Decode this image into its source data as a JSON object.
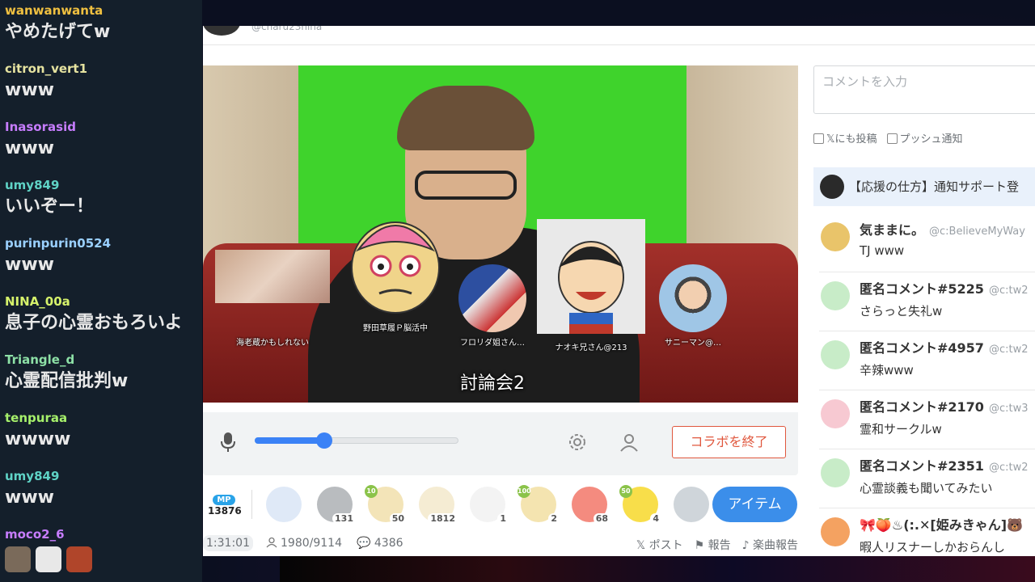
{
  "overlay_chat": [
    {
      "user": "wanwanwanta",
      "text": "やめたげてw",
      "color": "#f0c040"
    },
    {
      "user": "citron_vert1",
      "text": "www",
      "color": "#e6e3a0"
    },
    {
      "user": "Inasorasid",
      "text": "www",
      "color": "#c77dff"
    },
    {
      "user": "umy849",
      "text": "いいぞー！",
      "color": "#5fd3c6"
    },
    {
      "user": "purinpurin0524",
      "text": "www",
      "color": "#9ad0ff"
    },
    {
      "user": "NINA_00a",
      "text": "息子の心霊おもろいよ",
      "color": "#d6f26b"
    },
    {
      "user": "Triangle_d",
      "text": "心霊配信批判w",
      "color": "#8de0a6"
    },
    {
      "user": "tenpuraa",
      "text": "wwww",
      "color": "#a6f06b"
    },
    {
      "user": "umy849",
      "text": "www",
      "color": "#5fd3c6"
    },
    {
      "user": "moco2_6",
      "text": "",
      "color": "#c77dff"
    }
  ],
  "host": {
    "id": "@charu23nina"
  },
  "video": {
    "title": "討論会2",
    "collaborators": [
      {
        "name": "海老蔵かもしれない"
      },
      {
        "name": "野田草履Ｐ脳活中"
      },
      {
        "name": "フロリダ姐さん…"
      },
      {
        "name": "ナオキ兄さん@213"
      },
      {
        "name": "サニーマン@…"
      }
    ]
  },
  "controls": {
    "volume": 0.34,
    "end_collab_label": "コラボを終了"
  },
  "itembar": {
    "mp_label": "MP",
    "mp_value": "13876",
    "items": [
      {
        "count": "",
        "level": "",
        "color": "#dfe9f7"
      },
      {
        "count": "131",
        "level": "",
        "color": "#b9bcbf"
      },
      {
        "count": "50",
        "level": "10",
        "color": "#f3e4b8"
      },
      {
        "count": "1812",
        "level": "",
        "color": "#f5ecd3"
      },
      {
        "count": "1",
        "level": "",
        "color": "#f3f3f3"
      },
      {
        "count": "2",
        "level": "100",
        "color": "#f4e4b0"
      },
      {
        "count": "68",
        "level": "",
        "color": "#f48b7f"
      },
      {
        "count": "4",
        "level": "50",
        "color": "#f8de4a"
      },
      {
        "count": "",
        "level": "",
        "color": "#cfd5da"
      }
    ],
    "items_button": "アイテム"
  },
  "stats": {
    "elapsed": "1:31:01",
    "viewers": "1980/9114",
    "comments": "4386"
  },
  "links": {
    "post": "ポスト",
    "report": "報告",
    "music_report": "楽曲報告"
  },
  "side": {
    "input_placeholder": "コメントを入力",
    "opt_x": "にも投稿",
    "opt_push": "プッシュ通知",
    "pinned": "【応援の仕方】通知サポート登",
    "comments": [
      {
        "name": "気ままに。",
        "id": "@c:BelieveMyWay",
        "text": "TJ www",
        "avatar": "#e9c46a"
      },
      {
        "name": "匿名コメント#5225",
        "id": "@c:tw2",
        "text": "さらっと失礼w",
        "avatar": "#c8ecc8"
      },
      {
        "name": "匿名コメント#4957",
        "id": "@c:tw2",
        "text": "辛辣www",
        "avatar": "#c8ecc8"
      },
      {
        "name": "匿名コメント#2170",
        "id": "@c:tw3",
        "text": "霊和サークルw",
        "avatar": "#f7c9d2"
      },
      {
        "name": "匿名コメント#2351",
        "id": "@c:tw2",
        "text": "心霊談義も聞いてみたい",
        "avatar": "#c8ecc8"
      },
      {
        "name": "🎀🍑♨(:.✕[姫みきゃん]🐻",
        "id": "",
        "text": "暇人リスナーしかおらんし",
        "avatar": "#f4a261"
      }
    ]
  }
}
